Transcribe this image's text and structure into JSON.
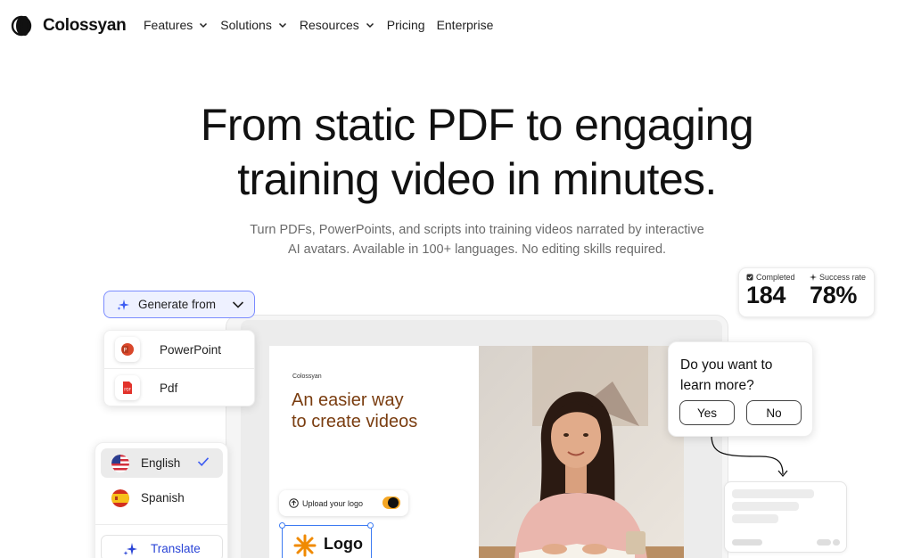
{
  "brand": {
    "name": "Colossyan"
  },
  "nav": {
    "items": [
      {
        "label": "Features",
        "has_dropdown": true
      },
      {
        "label": "Solutions",
        "has_dropdown": true
      },
      {
        "label": "Resources",
        "has_dropdown": true
      },
      {
        "label": "Pricing",
        "has_dropdown": false
      },
      {
        "label": "Enterprise",
        "has_dropdown": false
      }
    ]
  },
  "hero": {
    "title_line1": "From static PDF to engaging",
    "title_line2": "training video in minutes.",
    "subtitle_line1": "Turn PDFs, PowerPoints, and scripts into training videos narrated by interactive",
    "subtitle_line2": "AI avatars. Available in 100+ languages. No editing skills required."
  },
  "stats": {
    "completed_label": "Completed",
    "completed_value": "184",
    "success_label": "Success rate",
    "success_value": "78%"
  },
  "generate": {
    "label": "Generate from",
    "sources": [
      {
        "label": "PowerPoint",
        "icon": "powerpoint-icon"
      },
      {
        "label": "Pdf",
        "icon": "pdf-icon"
      }
    ]
  },
  "languages": {
    "items": [
      {
        "label": "English",
        "selected": true,
        "icon": "us-flag-icon"
      },
      {
        "label": "Spanish",
        "selected": false,
        "icon": "spain-flag-icon"
      }
    ],
    "translate_label": "Translate"
  },
  "slide": {
    "brand": "Colossyan",
    "headline_line1": "An easier way",
    "headline_line2": "to create videos",
    "upload_label": "Upload your logo",
    "logo_label": "Logo"
  },
  "question": {
    "text_line1": "Do you want to",
    "text_line2": "learn more?",
    "yes_label": "Yes",
    "no_label": "No"
  },
  "colors": {
    "accent": "#3d7bf2",
    "translate_blue": "#2a44d6",
    "headline_brown": "#7a3d10",
    "toggle_orange": "#f5a623",
    "logo_orange": "#f08a00"
  }
}
